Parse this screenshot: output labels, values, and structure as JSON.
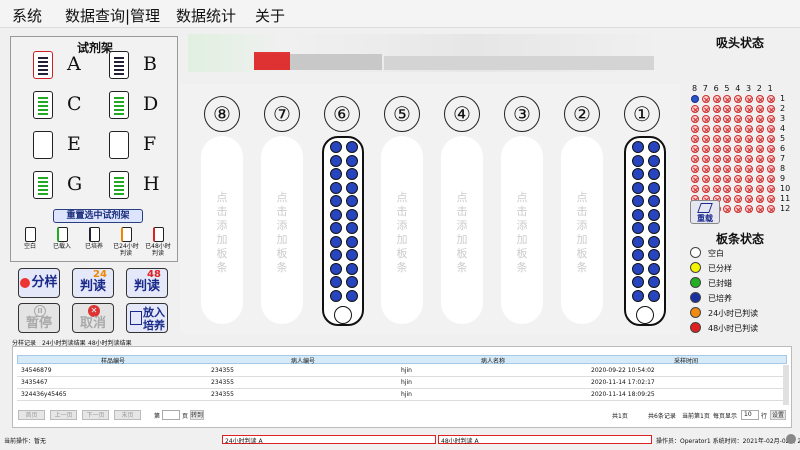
{
  "menu": [
    "系统",
    "数据查询|管理",
    "数据统计",
    "关于"
  ],
  "rack_panel": {
    "title": "试剂架",
    "racks": [
      "A",
      "B",
      "C",
      "D",
      "E",
      "F",
      "G",
      "H"
    ],
    "reselect": "重置选中试剂架",
    "legend": [
      "空白",
      "已载入",
      "已培养",
      "已24小时判读",
      "已48小时判读"
    ]
  },
  "actions": {
    "sample": "分样",
    "read24": "判读",
    "read48": "判读",
    "num24": "24",
    "num48": "48",
    "pause": "暂停",
    "cancel": "取消",
    "incubate": "放入培养"
  },
  "lanes": {
    "numbers": [
      "⑧",
      "⑦",
      "⑥",
      "⑤",
      "④",
      "③",
      "②",
      "①"
    ],
    "placeholder": "点击添加板条"
  },
  "tip_state": {
    "title": "吸头状态",
    "columns": [
      "8",
      "7",
      "6",
      "5",
      "4",
      "3",
      "2",
      "1"
    ],
    "rows": [
      "1",
      "2",
      "3",
      "4",
      "5",
      "6",
      "7",
      "8",
      "9",
      "10",
      "11",
      "12"
    ],
    "reload": "重载"
  },
  "plate_state": {
    "title": "板条状态",
    "items": [
      {
        "label": "空白",
        "color": "#ffffff"
      },
      {
        "label": "已分样",
        "color": "#f4f400"
      },
      {
        "label": "已封蜡",
        "color": "#22b022"
      },
      {
        "label": "已培养",
        "color": "#1a2fa0"
      },
      {
        "label": "24小时已判读",
        "color": "#f08a10"
      },
      {
        "label": "48小时已判读",
        "color": "#e02020"
      }
    ]
  },
  "tabs": [
    "分样记录",
    "24小时判读结果",
    "48小时判读结果"
  ],
  "table": {
    "headers": [
      "样品编号",
      "病人编号",
      "病人名称",
      "采样时间"
    ],
    "rows": [
      [
        "34546879",
        "234355",
        "hjin",
        "2020-09-22 10:54:02"
      ],
      [
        "3435467",
        "234355",
        "hjin",
        "2020-11-14 17:02:17"
      ],
      [
        "324436y45465",
        "234355",
        "hjin",
        "2020-11-14 18:09:25"
      ]
    ]
  },
  "pager": {
    "first": "首页",
    "prev": "上一页",
    "next": "下一页",
    "last": "末页",
    "page_prefix": "第",
    "page_suffix": "页",
    "go": "转到",
    "total_pages": "共1页",
    "total_records": "共6条记录",
    "current": "当前第1页",
    "per_page_label": "每页显示",
    "per_page": "10",
    "per_page_unit": "行",
    "set": "设置"
  },
  "status": {
    "op": "当前操作：暂无",
    "alarm1": "24小时判读 A",
    "alarm2": "48小时判读 A",
    "operator": "操作员：Operator1  系统时间：2021年-02月-02日  22:31:39"
  }
}
